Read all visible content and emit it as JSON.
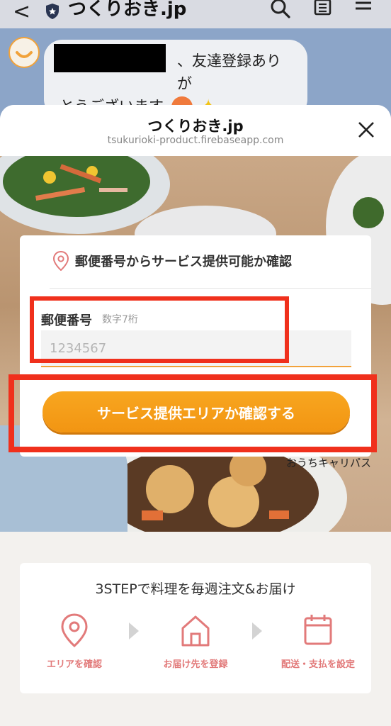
{
  "line_header": {
    "back_glyph": "<",
    "title": "つくりおき.jp",
    "icons": [
      "shield-icon",
      "search-icon",
      "notes-icon",
      "menu-icon"
    ]
  },
  "chat": {
    "message_line1": "、友達登録ありが",
    "message_line2": "とうございます"
  },
  "sheet": {
    "title": "つくりおき.jp",
    "url": "tsukurioki-product.firebaseapp.com",
    "close_icon": "close-icon"
  },
  "postal_card": {
    "heading": "郵便番号からサービス提供可能か確認",
    "field_label": "郵便番号",
    "field_hint": "数字7桁",
    "field_placeholder": "1234567",
    "field_value": "",
    "button_label": "サービス提供エリアか確認する"
  },
  "hero_credit": "おうちキャリパス",
  "steps": {
    "title": "3STEPで料理を毎週注文&お届け",
    "items": [
      {
        "label": "エリアを確認",
        "icon": "location-pin-icon"
      },
      {
        "label": "お届け先を登録",
        "icon": "house-icon"
      },
      {
        "label": "配送・支払を設定",
        "icon": "calendar-icon"
      }
    ]
  },
  "colors": {
    "accent_orange": "#F29512",
    "highlight_red": "#F0301C",
    "step_pink": "#E27A7A"
  }
}
